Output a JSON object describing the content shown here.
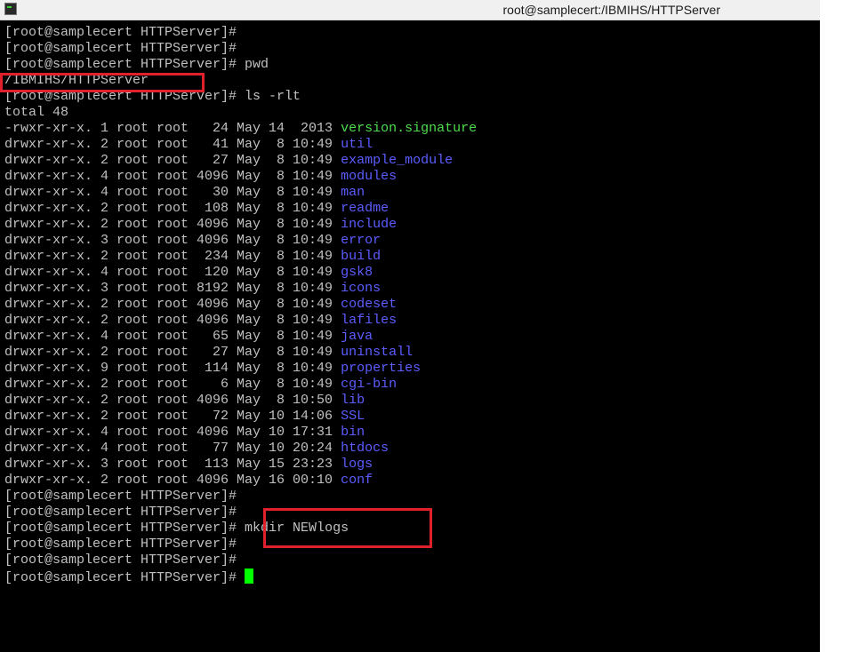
{
  "window": {
    "title": "root@samplecert:/IBMIHS/HTTPServer"
  },
  "terminal": {
    "prompt": "[root@samplecert HTTPServer]#",
    "lines_before": [
      {
        "cmd": ""
      },
      {
        "cmd": ""
      },
      {
        "cmd": " pwd"
      }
    ],
    "pwd_output": "/IBMIHS/HTTPServer",
    "ls_cmd": " ls -rlt",
    "total": "total 48",
    "listing": [
      {
        "meta": "-rwxr-xr-x. 1 root root   24 May 14  2013 ",
        "name": "version.signature",
        "kind": "file"
      },
      {
        "meta": "drwxr-xr-x. 2 root root   41 May  8 10:49 ",
        "name": "util",
        "kind": "dir"
      },
      {
        "meta": "drwxr-xr-x. 2 root root   27 May  8 10:49 ",
        "name": "example_module",
        "kind": "dir"
      },
      {
        "meta": "drwxr-xr-x. 4 root root 4096 May  8 10:49 ",
        "name": "modules",
        "kind": "dir"
      },
      {
        "meta": "drwxr-xr-x. 4 root root   30 May  8 10:49 ",
        "name": "man",
        "kind": "dir"
      },
      {
        "meta": "drwxr-xr-x. 2 root root  108 May  8 10:49 ",
        "name": "readme",
        "kind": "dir"
      },
      {
        "meta": "drwxr-xr-x. 2 root root 4096 May  8 10:49 ",
        "name": "include",
        "kind": "dir"
      },
      {
        "meta": "drwxr-xr-x. 3 root root 4096 May  8 10:49 ",
        "name": "error",
        "kind": "dir"
      },
      {
        "meta": "drwxr-xr-x. 2 root root  234 May  8 10:49 ",
        "name": "build",
        "kind": "dir"
      },
      {
        "meta": "drwxr-xr-x. 4 root root  120 May  8 10:49 ",
        "name": "gsk8",
        "kind": "dir"
      },
      {
        "meta": "drwxr-xr-x. 3 root root 8192 May  8 10:49 ",
        "name": "icons",
        "kind": "dir"
      },
      {
        "meta": "drwxr-xr-x. 2 root root 4096 May  8 10:49 ",
        "name": "codeset",
        "kind": "dir"
      },
      {
        "meta": "drwxr-xr-x. 2 root root 4096 May  8 10:49 ",
        "name": "lafiles",
        "kind": "dir"
      },
      {
        "meta": "drwxr-xr-x. 4 root root   65 May  8 10:49 ",
        "name": "java",
        "kind": "dir"
      },
      {
        "meta": "drwxr-xr-x. 2 root root   27 May  8 10:49 ",
        "name": "uninstall",
        "kind": "dir"
      },
      {
        "meta": "drwxr-xr-x. 9 root root  114 May  8 10:49 ",
        "name": "properties",
        "kind": "dir"
      },
      {
        "meta": "drwxr-xr-x. 2 root root    6 May  8 10:49 ",
        "name": "cgi-bin",
        "kind": "dir"
      },
      {
        "meta": "drwxr-xr-x. 2 root root 4096 May  8 10:50 ",
        "name": "lib",
        "kind": "dir"
      },
      {
        "meta": "drwxr-xr-x. 2 root root   72 May 10 14:06 ",
        "name": "SSL",
        "kind": "dir"
      },
      {
        "meta": "drwxr-xr-x. 4 root root 4096 May 10 17:31 ",
        "name": "bin",
        "kind": "dir"
      },
      {
        "meta": "drwxr-xr-x. 4 root root   77 May 10 20:24 ",
        "name": "htdocs",
        "kind": "dir"
      },
      {
        "meta": "drwxr-xr-x. 3 root root  113 May 15 23:23 ",
        "name": "logs",
        "kind": "dir"
      },
      {
        "meta": "drwxr-xr-x. 2 root root 4096 May 16 00:10 ",
        "name": "conf",
        "kind": "dir"
      }
    ],
    "lines_after": [
      {
        "cmd": ""
      },
      {
        "cmd": ""
      },
      {
        "cmd": " mkdir NEWlogs"
      },
      {
        "cmd": ""
      },
      {
        "cmd": ""
      },
      {
        "cmd": " "
      }
    ]
  },
  "colors": {
    "background": "#000000",
    "text": "#c0c0c0",
    "directory": "#5c5cff",
    "executable_file": "#4edc4e",
    "cursor": "#00ff00",
    "highlight": "#e0202a"
  }
}
